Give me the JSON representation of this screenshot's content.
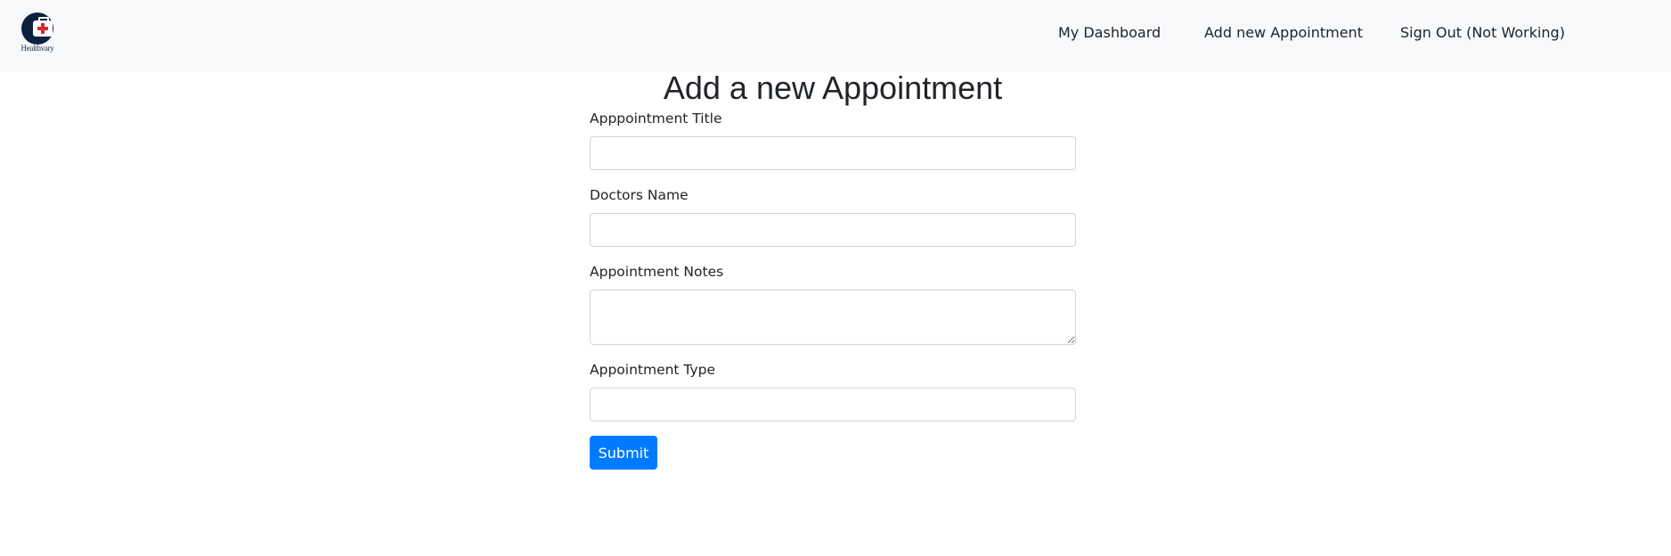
{
  "header": {
    "logo_text": "Healthvary",
    "nav": {
      "dashboard": "My Dashboard",
      "add_appointment": "Add new Appointment",
      "sign_out": "Sign Out (Not Working)"
    }
  },
  "main": {
    "title": "Add a new Appointment",
    "form": {
      "title_label": "Apppointment Title",
      "title_value": "",
      "doctor_label": "Doctors Name",
      "doctor_value": "",
      "notes_label": "Appointment Notes",
      "notes_value": "",
      "type_label": "Appointment Type",
      "type_value": "",
      "submit_label": "Submit"
    }
  },
  "colors": {
    "navbar_bg": "#f8f9fa",
    "primary": "#007bff",
    "logo_navy": "#0d2240",
    "logo_red": "#d62b2b"
  }
}
